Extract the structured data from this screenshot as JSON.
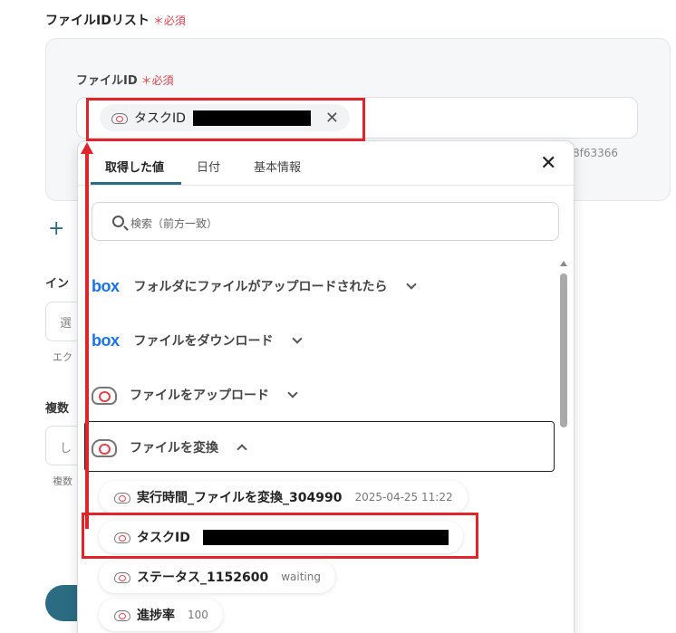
{
  "form": {
    "list_label": "ファイルIDリスト",
    "required_mark": "＊必須",
    "file_id_label": "ファイルID",
    "chip_label": "タスクID",
    "field_tail": "8f63366",
    "add_glyph": "+",
    "peek_label_1": "イン",
    "peek_input_1": "選",
    "peek_help_1": "エク",
    "peek_label_2": "複数",
    "peek_input_2": "し",
    "peek_help_2": "複数"
  },
  "panel": {
    "tabs": [
      {
        "label": "取得した値",
        "active": true
      },
      {
        "label": "日付",
        "active": false
      },
      {
        "label": "基本情報",
        "active": false
      }
    ],
    "close_glyph": "✕",
    "search_placeholder": "検索（前方一致）",
    "groups": [
      {
        "icon": "box-logo",
        "logo_text": "box",
        "label": "フォルダにファイルがアップロードされたら",
        "expanded": false
      },
      {
        "icon": "box-logo",
        "logo_text": "box",
        "label": "ファイルをダウンロード",
        "expanded": false
      },
      {
        "icon": "cloud-icon",
        "label": "ファイルをアップロード",
        "expanded": false
      },
      {
        "icon": "cloud-icon",
        "label": "ファイルを変換",
        "expanded": true
      }
    ],
    "items": [
      {
        "label": "実行時間_ファイルを変換_304990",
        "value": "2025-04-25 11:22"
      },
      {
        "label": "タスクID",
        "value": ""
      },
      {
        "label": "ステータス_1152600",
        "value": "waiting"
      },
      {
        "label": "進捗率",
        "value": "100"
      }
    ]
  },
  "colors": {
    "accent": "#2b6c82",
    "required": "#e0424a",
    "annotation": "#e0242a",
    "box_brand": "#1a73e8"
  }
}
